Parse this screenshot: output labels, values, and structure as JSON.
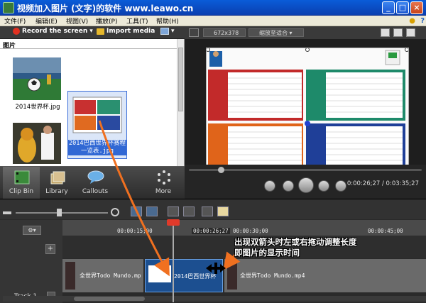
{
  "window": {
    "title": "视频加入图片 (文字)的软件 www.leawo.cn"
  },
  "menu": [
    "文件(F)",
    "编辑(E)",
    "视图(V)",
    "播放(P)",
    "工具(T)",
    "帮助(H)"
  ],
  "toolbar": {
    "record_label": "Record the screen",
    "import_label": "Import media"
  },
  "clip_bin": {
    "header": "图片",
    "items": [
      {
        "caption": "2014世界杯.jpg"
      },
      {
        "caption": "2014巴西世界杯赛程一览表.jpg"
      }
    ]
  },
  "tabs": [
    "Clip Bin",
    "Library",
    "Callouts",
    "More"
  ],
  "preview": {
    "size": "672x378",
    "zoom": "缩放至适合",
    "timecode": "0:00:26;27 / 0:03:35;27"
  },
  "timeline": {
    "ruler_labels": [
      "00:00:15;00",
      "00:00:26;27",
      "00:00:30;00",
      "00:00:45;00"
    ],
    "track_label": "Track 1",
    "clips": [
      "全世界Todo Mundo.mp",
      "2014巴西世界杯",
      "全世界Todo Mundo.mp4"
    ]
  },
  "annotation": {
    "line1": "出现双箭头时左或右拖动调整长度",
    "line2": "即图片的显示时间"
  },
  "colors": {
    "title_blue": "#0a4fc8",
    "arrow_orange": "#f07020",
    "selection_blue": "#3168d4"
  }
}
